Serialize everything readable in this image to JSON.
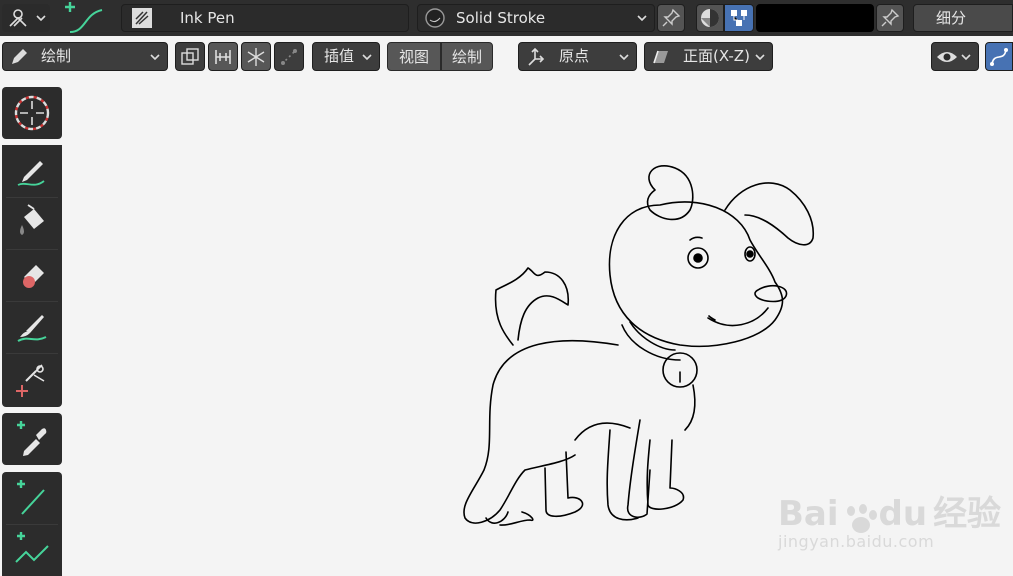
{
  "header": {
    "brush_name": "Ink Pen",
    "material_name": "Solid Stroke",
    "subdivide_label": "细分"
  },
  "toolbar": {
    "mode_label": "绘制",
    "interpolate_label": "插值",
    "view_label": "视图",
    "draw_label": "绘制",
    "pivot_label": "原点",
    "orientation_label": "正面(X-Z)"
  },
  "tools": [
    {
      "name": "cursor-icon"
    },
    {
      "name": "draw-icon"
    },
    {
      "name": "fill-icon"
    },
    {
      "name": "erase-icon"
    },
    {
      "name": "tint-icon"
    },
    {
      "name": "cutter-icon"
    },
    {
      "name": "eyedropper-icon"
    },
    {
      "name": "line-icon"
    },
    {
      "name": "polyline-icon"
    }
  ],
  "watermark": {
    "logo_text_1": "Bai",
    "logo_text_2": "du",
    "logo_text_3": "经验",
    "url": "jingyan.baidu.com"
  },
  "colors": {
    "accent_green": "#46d49a",
    "active_blue": "#4772b3",
    "header_bg": "#2e2e2e",
    "canvas_bg": "#f4f4f4"
  }
}
